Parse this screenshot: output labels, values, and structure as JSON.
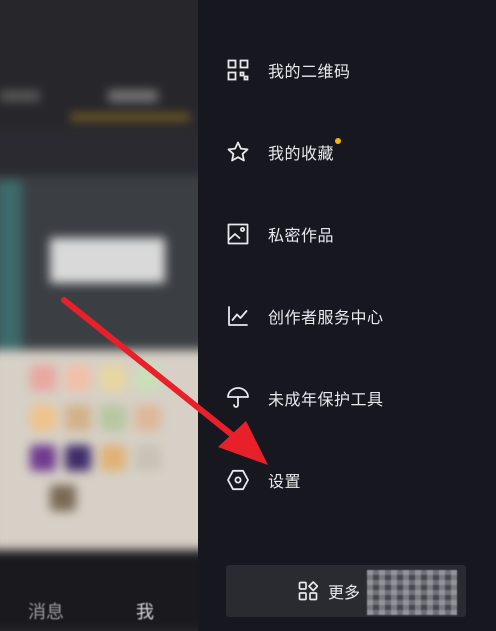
{
  "background": {
    "bottom_nav": {
      "messages": "消息",
      "me": "我"
    }
  },
  "drawer": {
    "items": [
      {
        "label": "我的二维码",
        "icon": "qr-code-icon"
      },
      {
        "label": "我的收藏",
        "icon": "star-icon",
        "badge_color": "#f5b50d"
      },
      {
        "label": "私密作品",
        "icon": "image-icon"
      },
      {
        "label": "创作者服务中心",
        "icon": "line-chart-icon"
      },
      {
        "label": "未成年保护工具",
        "icon": "umbrella-icon"
      },
      {
        "label": "设置",
        "icon": "hexagon-settings-icon"
      }
    ],
    "more_button": {
      "label": "更多",
      "icon": "grid-icon"
    }
  },
  "annotation": {
    "arrow_color": "#e8202a"
  }
}
